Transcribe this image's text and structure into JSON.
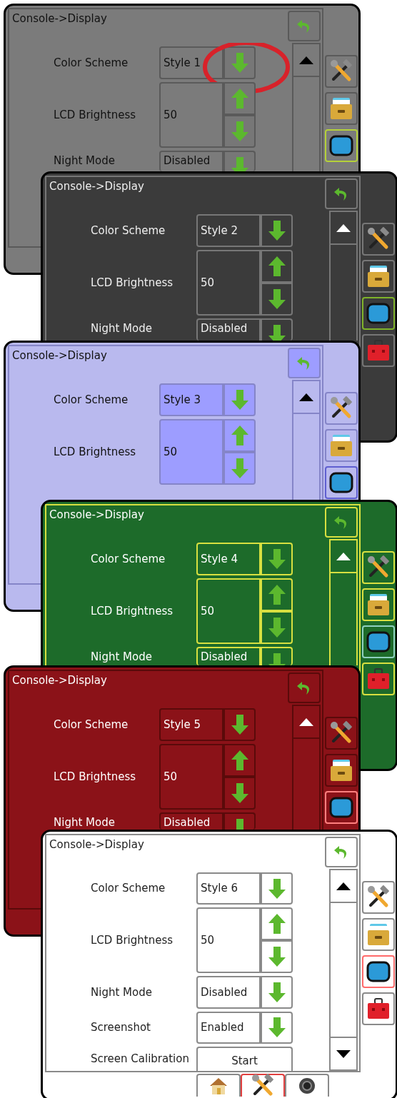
{
  "panels": [
    {
      "title": "Console->Display",
      "rows": [
        {
          "kind": "select",
          "label": "Color Scheme",
          "value": "Style 1",
          "circled": true
        },
        {
          "kind": "stepper",
          "label": "LCD Brightness",
          "value": "50",
          "circled": false
        },
        {
          "kind": "select",
          "label": "Night Mode",
          "value": "Disabled",
          "circled": false
        }
      ],
      "side_tabs": [
        {
          "kind": "tools",
          "selected": false
        },
        {
          "kind": "drawer",
          "selected": false
        },
        {
          "kind": "display",
          "selected": true
        }
      ]
    },
    {
      "title": "Console->Display",
      "rows": [
        {
          "kind": "select",
          "label": "Color Scheme",
          "value": "Style 2",
          "circled": false
        },
        {
          "kind": "stepper",
          "label": "LCD Brightness",
          "value": "50",
          "circled": false
        },
        {
          "kind": "select",
          "label": "Night Mode",
          "value": "Disabled",
          "circled": false
        }
      ],
      "side_tabs": [
        {
          "kind": "tools",
          "selected": false
        },
        {
          "kind": "drawer",
          "selected": false
        },
        {
          "kind": "display",
          "selected": true
        },
        {
          "kind": "toolbox",
          "selected": false
        }
      ]
    },
    {
      "title": "Console->Display",
      "rows": [
        {
          "kind": "select",
          "label": "Color Scheme",
          "value": "Style 3",
          "circled": false
        },
        {
          "kind": "stepper",
          "label": "LCD Brightness",
          "value": "50",
          "circled": false
        }
      ],
      "side_tabs": [
        {
          "kind": "tools",
          "selected": false
        },
        {
          "kind": "drawer",
          "selected": false
        },
        {
          "kind": "display",
          "selected": true
        }
      ]
    },
    {
      "title": "Console->Display",
      "rows": [
        {
          "kind": "select",
          "label": "Color Scheme",
          "value": "Style 4",
          "circled": false
        },
        {
          "kind": "stepper",
          "label": "LCD Brightness",
          "value": "50",
          "circled": false
        },
        {
          "kind": "select",
          "label": "Night Mode",
          "value": "Disabled",
          "circled": false
        }
      ],
      "side_tabs": [
        {
          "kind": "tools",
          "selected": false
        },
        {
          "kind": "drawer",
          "selected": false
        },
        {
          "kind": "display",
          "selected": true
        },
        {
          "kind": "toolbox",
          "selected": false
        }
      ]
    },
    {
      "title": "Console->Display",
      "rows": [
        {
          "kind": "select",
          "label": "Color Scheme",
          "value": "Style 5",
          "circled": false
        },
        {
          "kind": "stepper",
          "label": "LCD Brightness",
          "value": "50",
          "circled": false
        },
        {
          "kind": "select",
          "label": "Night Mode",
          "value": "Disabled",
          "circled": false
        }
      ],
      "side_tabs": [
        {
          "kind": "tools",
          "selected": false
        },
        {
          "kind": "drawer",
          "selected": false
        },
        {
          "kind": "display",
          "selected": true
        }
      ]
    },
    {
      "title": "Console->Display",
      "rows": [
        {
          "kind": "select",
          "label": "Color Scheme",
          "value": "Style 6",
          "circled": false
        },
        {
          "kind": "stepper",
          "label": "LCD Brightness",
          "value": "50",
          "circled": false
        },
        {
          "kind": "select",
          "label": "Night Mode",
          "value": "Disabled",
          "circled": false
        },
        {
          "kind": "select",
          "label": "Screenshot",
          "value": "Enabled",
          "circled": false
        },
        {
          "kind": "action",
          "label": "Screen Calibration",
          "value": "Start",
          "circled": false
        }
      ],
      "side_tabs": [
        {
          "kind": "tools",
          "selected": false
        },
        {
          "kind": "drawer",
          "selected": false
        },
        {
          "kind": "display",
          "selected": true
        },
        {
          "kind": "toolbox",
          "selected": false
        }
      ],
      "bottom_tabs": [
        {
          "kind": "home",
          "selected": false
        },
        {
          "kind": "tools",
          "selected": true
        },
        {
          "kind": "camera",
          "selected": false
        }
      ]
    }
  ]
}
